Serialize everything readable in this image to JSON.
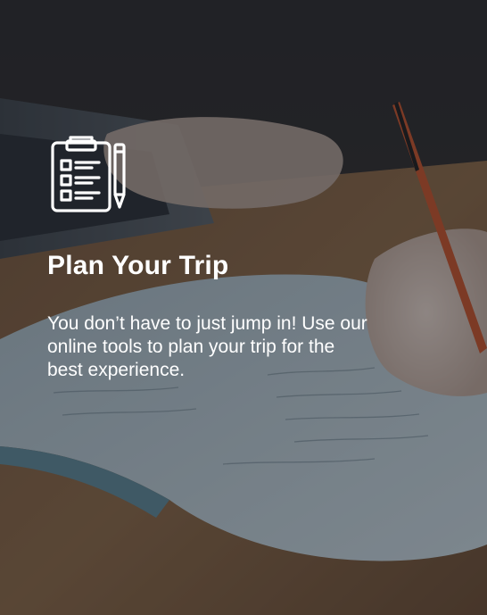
{
  "card": {
    "title": "Plan Your Trip",
    "description": "You don’t have to just jump in! Use our online tools to plan your trip for the best experience.",
    "icon": "clipboard-checklist-pencil-icon",
    "background": "photo of a hand writing in a notebook next to a laptop",
    "colors": {
      "text": "#ffffff",
      "overlay": "#12161c"
    }
  }
}
